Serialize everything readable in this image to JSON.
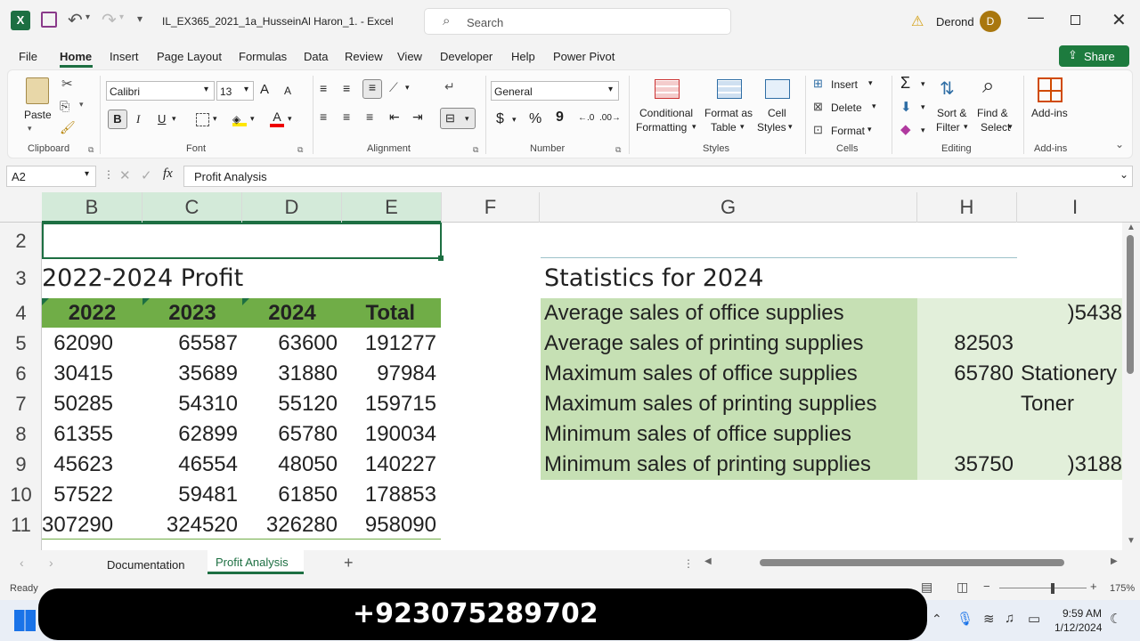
{
  "title_bar": {
    "filename": "IL_EX365_2021_1a_HusseinAl Haron_1.  -  Excel",
    "search_placeholder": "Search",
    "user_name": "Derond",
    "user_initial": "D"
  },
  "menu": {
    "items": [
      "File",
      "Home",
      "Insert",
      "Page Layout",
      "Formulas",
      "Data",
      "Review",
      "View",
      "Developer",
      "Help",
      "Power Pivot"
    ],
    "share_label": "Share"
  },
  "ribbon": {
    "clipboard": {
      "paste": "Paste",
      "group": "Clipboard"
    },
    "font": {
      "name": "Calibri",
      "size": "13",
      "group": "Font",
      "bold": "B",
      "italic": "I",
      "underline": "U",
      "grow": "A",
      "shrink": "A"
    },
    "alignment": {
      "group": "Alignment"
    },
    "number": {
      "format": "General",
      "group": "Number",
      "currency": "$",
      "percent": "%",
      "comma": "9"
    },
    "styles": {
      "conditional": "Conditional",
      "conditional2": "Formatting",
      "format_table": "Format as",
      "format_table2": "Table",
      "cell_styles": "Cell",
      "cell_styles2": "Styles",
      "group": "Styles"
    },
    "cells": {
      "insert": "Insert",
      "delete": "Delete",
      "format": "Format",
      "group": "Cells"
    },
    "editing": {
      "sort": "Sort &",
      "sort2": "Filter",
      "find": "Find &",
      "find2": "Select",
      "group": "Editing"
    },
    "addins": {
      "label": "Add-ins",
      "group": "Add-ins"
    }
  },
  "formula_bar": {
    "name_box": "A2",
    "fx": "fx",
    "content": "Profit Analysis"
  },
  "sheet": {
    "columns": [
      "B",
      "C",
      "D",
      "E",
      "F",
      "G",
      "H",
      "I"
    ],
    "rows": [
      "2",
      "3",
      "4",
      "5",
      "6",
      "7",
      "8",
      "9",
      "10",
      "11"
    ],
    "title_left": "2022-2024 Profit",
    "header": [
      "2022",
      "2023",
      "2024",
      "Total"
    ],
    "data": [
      [
        "62090",
        "65587",
        "63600",
        "191277"
      ],
      [
        "30415",
        "35689",
        "31880",
        "97984"
      ],
      [
        "50285",
        "54310",
        "55120",
        "159715"
      ],
      [
        "61355",
        "62899",
        "65780",
        "190034"
      ],
      [
        "45623",
        "46554",
        "48050",
        "140227"
      ],
      [
        "57522",
        "59481",
        "61850",
        "178853"
      ],
      [
        "307290",
        "324520",
        "326280",
        "958090"
      ]
    ],
    "stats_title": "Statistics for 2024",
    "stats": [
      {
        "label": "Average sales of office supplies",
        "h": "",
        "i": "5438("
      },
      {
        "label": "Average sales of printing supplies",
        "h": "82503",
        "i": ""
      },
      {
        "label": "Maximum sales of office supplies",
        "h": "65780",
        "i": "Stationery"
      },
      {
        "label": "Maximum sales of printing supplies",
        "h": "",
        "i": "Toner"
      },
      {
        "label": "Minimum sales of office supplies",
        "h": "",
        "i": ""
      },
      {
        "label": "Minimum sales of printing supplies",
        "h": "35750",
        "i": "3188("
      }
    ],
    "accent_green": "#70ad47",
    "light_green": "#c6e0b4"
  },
  "sheet_tabs": {
    "tabs": [
      "Documentation",
      "Profit Analysis"
    ],
    "active": "Profit Analysis"
  },
  "status": {
    "ready": "Ready",
    "zoom": "175%"
  },
  "taskbar": {
    "phone": "+923075289702",
    "time": "9:59 AM",
    "date": "1/12/2024"
  }
}
